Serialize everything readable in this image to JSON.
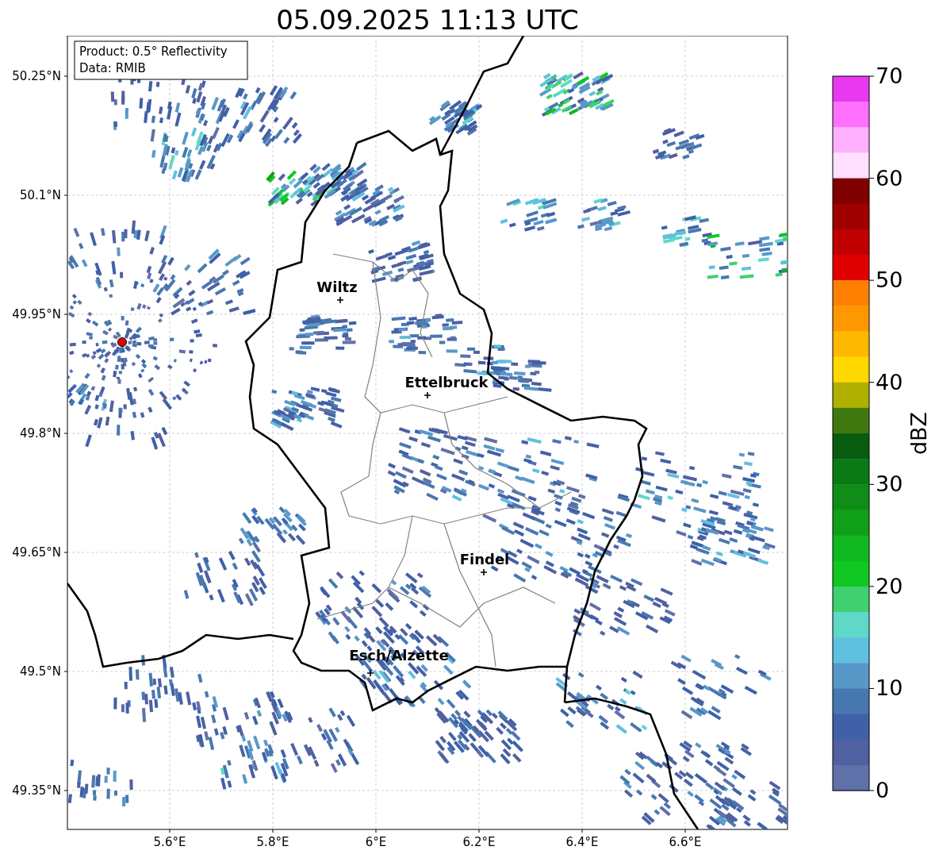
{
  "title": "05.09.2025 11:13 UTC",
  "info_box": [
    "Product: 0.5° Reflectivity",
    "Data: RMIB"
  ],
  "map": {
    "xticks": [
      "5.6°E",
      "5.8°E",
      "6°E",
      "6.2°E",
      "6.4°E",
      "6.6°E"
    ],
    "yticks": [
      "50.25°N",
      "50.1°N",
      "49.95°N",
      "49.8°N",
      "49.65°N",
      "49.5°N",
      "49.35°N"
    ],
    "cities": [
      {
        "name": "Wiltz"
      },
      {
        "name": "Ettelbruck"
      },
      {
        "name": "Findel"
      },
      {
        "name": "Esch/Alzette"
      }
    ]
  },
  "colorbar": {
    "label": "dBZ",
    "ticks": [
      "70",
      "60",
      "50",
      "40",
      "30",
      "20",
      "10",
      "0"
    ],
    "segments": [
      {
        "color": "#e838f0"
      },
      {
        "color": "#ff70ff"
      },
      {
        "color": "#ffb0ff"
      },
      {
        "color": "#ffe0ff"
      },
      {
        "color": "#800000"
      },
      {
        "color": "#a00000"
      },
      {
        "color": "#c00000"
      },
      {
        "color": "#e00000"
      },
      {
        "color": "#ff8000"
      },
      {
        "color": "#ff9800"
      },
      {
        "color": "#ffb800"
      },
      {
        "color": "#ffd800"
      },
      {
        "color": "#b0b000"
      },
      {
        "color": "#407810"
      },
      {
        "color": "#085c10"
      },
      {
        "color": "#0a7a14"
      },
      {
        "color": "#108c18"
      },
      {
        "color": "#10a018"
      },
      {
        "color": "#10b820"
      },
      {
        "color": "#10c820"
      },
      {
        "color": "#40d070"
      },
      {
        "color": "#60d8c8"
      },
      {
        "color": "#60c0e0"
      },
      {
        "color": "#5898c8"
      },
      {
        "color": "#4878b0"
      },
      {
        "color": "#4060a8"
      },
      {
        "color": "#5060a0"
      },
      {
        "color": "#6070a8"
      }
    ]
  }
}
